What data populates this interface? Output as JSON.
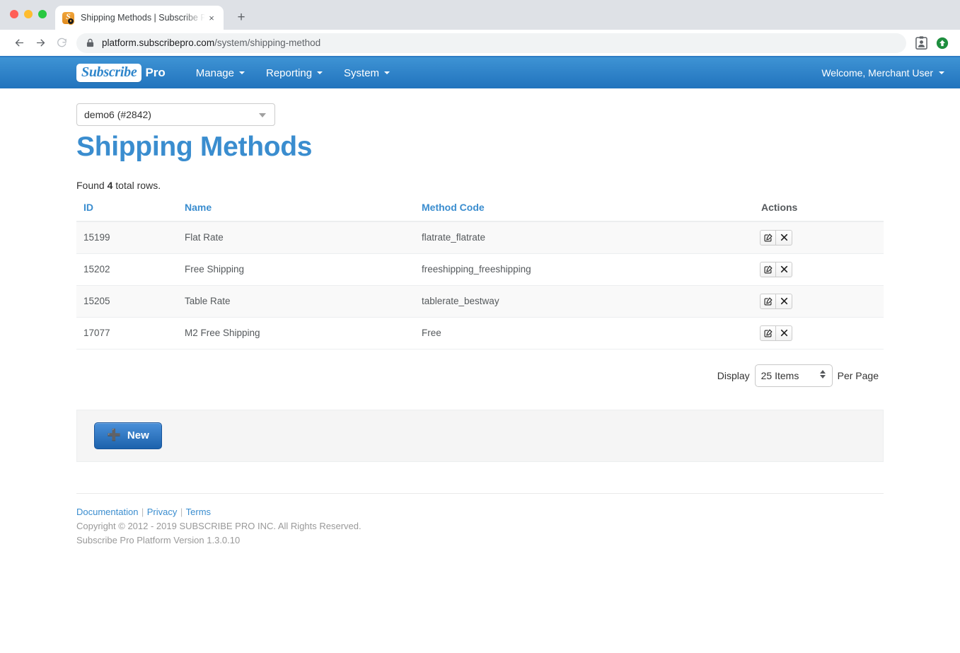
{
  "browser": {
    "tab": {
      "title": "Shipping Methods | Subscribe Pro",
      "favicon_letter": "S",
      "close_label": "×"
    },
    "new_tab_label": "+",
    "url_host": "platform.subscribepro.com",
    "url_path": "/system/shipping-method",
    "back_icon": "back-arrow-icon",
    "forward_icon": "forward-arrow-icon",
    "reload_icon": "reload-icon",
    "lock_icon": "lock-icon",
    "profile_icon": "profile-card-icon",
    "update_icon": "update-available-icon"
  },
  "navbar": {
    "brand_main": "Subscribe",
    "brand_sub": "Pro",
    "items": [
      {
        "label": "Manage",
        "has_caret": true
      },
      {
        "label": "Reporting",
        "has_caret": true
      },
      {
        "label": "System",
        "has_caret": true
      }
    ],
    "user_menu": "Welcome, Merchant User",
    "accent_color": "#2173bd"
  },
  "page": {
    "account_select_value": "demo6 (#2842)",
    "title": "Shipping Methods",
    "found_prefix": "Found ",
    "found_count": "4",
    "found_suffix": " total rows.",
    "title_color": "#3a8dcf"
  },
  "table": {
    "columns": [
      "ID",
      "Name",
      "Method Code",
      "Actions"
    ],
    "rows": [
      {
        "id": "15199",
        "name": "Flat Rate",
        "code": "flatrate_flatrate"
      },
      {
        "id": "15202",
        "name": "Free Shipping",
        "code": "freeshipping_freeshipping"
      },
      {
        "id": "15205",
        "name": "Table Rate",
        "code": "tablerate_bestway"
      },
      {
        "id": "17077",
        "name": "M2 Free Shipping",
        "code": "Free"
      }
    ],
    "row_actions": {
      "edit_icon": "edit-pencil-square-icon",
      "delete_icon": "delete-x-icon"
    }
  },
  "pager": {
    "display_label": "Display",
    "per_page_value": "25 Items",
    "per_page_label": "Per Page"
  },
  "panel": {
    "new_button_label": "New",
    "new_button_icon": "plus-icon"
  },
  "footer": {
    "links": [
      "Documentation",
      "Privacy",
      "Terms"
    ],
    "separator": "|",
    "copyright": "Copyright © 2012 - 2019 SUBSCRIBE PRO INC. All Rights Reserved.",
    "version": "Subscribe Pro Platform Version 1.3.0.10"
  }
}
